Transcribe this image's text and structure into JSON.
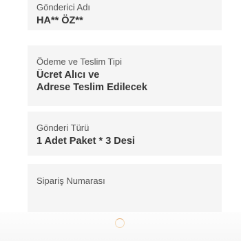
{
  "sender": {
    "label": "Gönderici Adı",
    "value": "HA** ÖZ**"
  },
  "payment": {
    "label": "Ödeme ve Teslim Tipi",
    "value_line1": "Ücret Alıcı ve",
    "value_line2": "Adrese Teslim Edilecek"
  },
  "shipment_type": {
    "label": "Gönderi Türü",
    "value": "1 Adet Paket * 3 Desi"
  },
  "order": {
    "label": "Sipariş Numarası",
    "value": ""
  },
  "loading": {
    "icon": "loading-spinner-icon",
    "color": "#e7b27a"
  }
}
